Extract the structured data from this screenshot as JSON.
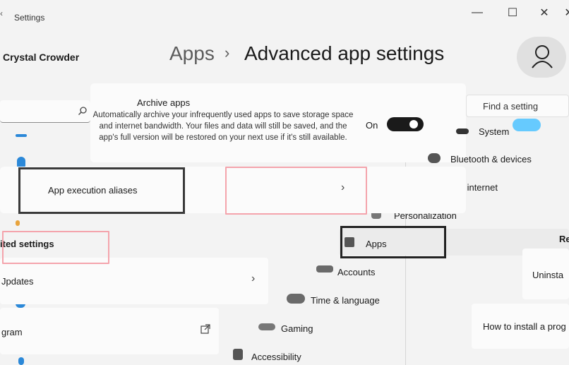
{
  "window": {
    "title": "Settings",
    "minimize_glyph": "—",
    "maximize_glyph": "☐",
    "close_glyph": "✕"
  },
  "sidebar": {
    "user_name": "Crystal Crowder",
    "related_settings_header": "ited settings",
    "updates_label": "Jpdates",
    "program_label": "gram"
  },
  "breadcrumb": {
    "parent": "Apps",
    "separator": "›",
    "current": "Advanced app settings"
  },
  "archive": {
    "title": "Archive apps",
    "description": "Automatically archive your infrequently used apps to save storage space and internet bandwidth. Your files and data will still be saved, and the app's full version will be restored on your next use if it's still available.",
    "toggle_state": "On"
  },
  "alias": {
    "label": "App execution aliases",
    "chevron": "›"
  },
  "search": {
    "placeholder": "Find a setting"
  },
  "nav": {
    "items": [
      {
        "label": "System",
        "icon": "monitor-icon"
      },
      {
        "label": "Bluetooth & devices",
        "icon": "bluetooth-icon"
      },
      {
        "label": "Network & internet",
        "icon": "wifi-icon"
      },
      {
        "label": "Personalization",
        "icon": "brush-icon"
      },
      {
        "label": "Apps",
        "icon": "apps-icon"
      },
      {
        "label": "Accounts",
        "icon": "person-icon"
      },
      {
        "label": "Time & language",
        "icon": "globe-clock-icon"
      },
      {
        "label": "Gaming",
        "icon": "gamepad-icon"
      },
      {
        "label": "Accessibility",
        "icon": "accessibility-icon"
      }
    ]
  },
  "related_right": {
    "header": "Re",
    "uninstall": "Uninsta",
    "howto": "How to install a prog"
  },
  "colors": {
    "accent": "#4cc2ff",
    "highlight": "#f4a4ac",
    "background": "#f3f3f3"
  }
}
